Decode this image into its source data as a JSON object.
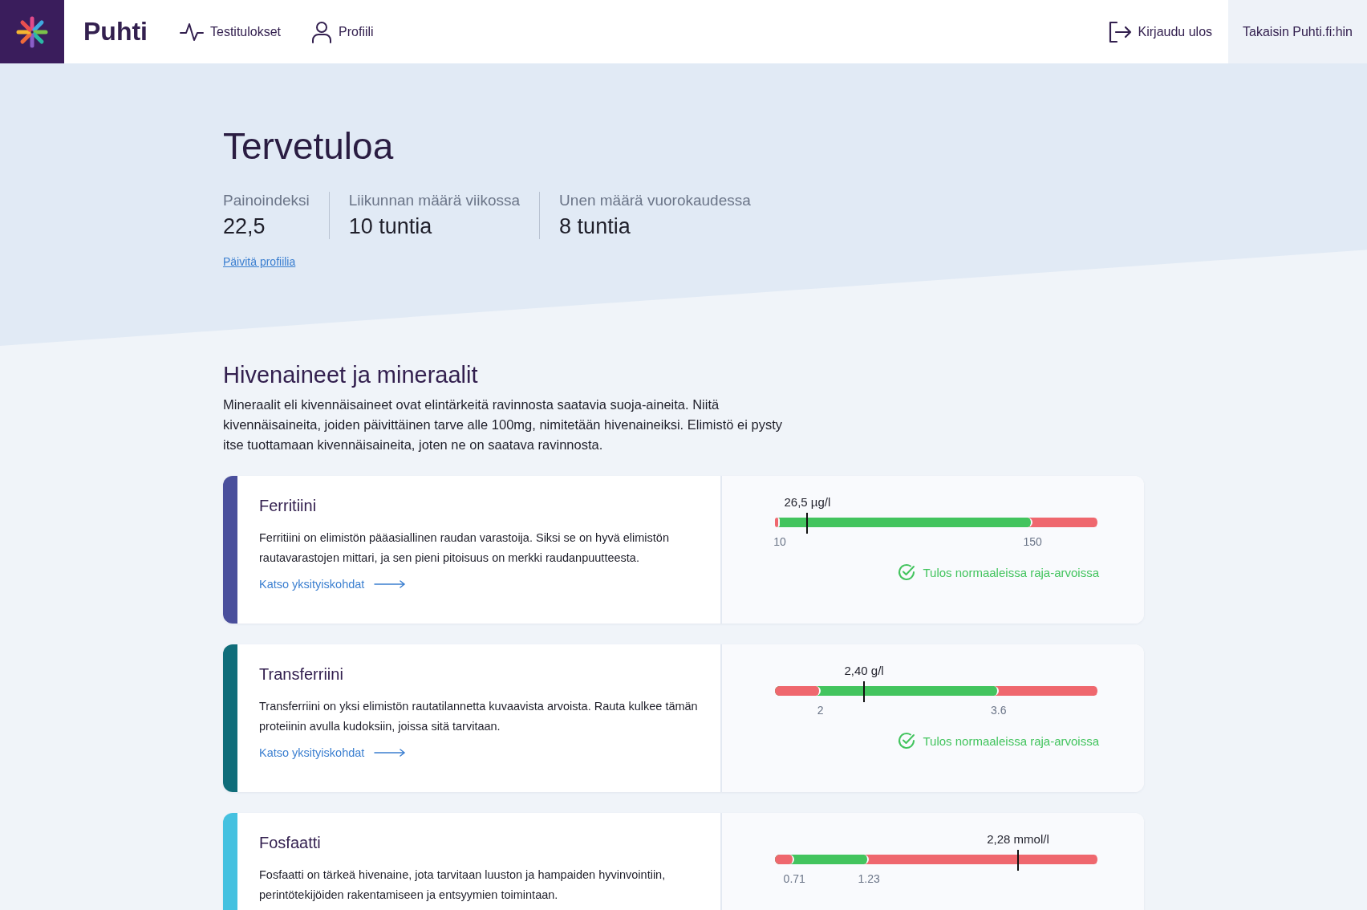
{
  "header": {
    "brand": "Puhti",
    "nav": [
      {
        "label": "Testitulokset",
        "selected": false
      },
      {
        "label": "Profiili",
        "selected": false
      }
    ],
    "logout": "Kirjaudu ulos",
    "back_link": "Takaisin Puhti.fi:hin"
  },
  "hero": {
    "title": "Tervetuloa",
    "stats": [
      {
        "label": "Painoindeksi",
        "value": "22,5"
      },
      {
        "label": "Liikunnan määrä viikossa",
        "value": "10 tuntia"
      },
      {
        "label": "Unen määrä vuorokaudessa",
        "value": "8 tuntia"
      }
    ],
    "update_link": "Päivitä profiilia"
  },
  "section": {
    "title": "Hivenaineet ja mineraalit",
    "description": "Mineraalit eli kivennäisaineet ovat elintärkeitä ravinnosta saatavia suoja-aineita. Niitä kivennäisaineita, joiden päivittäinen tarve alle 100mg, nimitetään hivenaineiksi. Elimistö ei pysty itse tuottamaan kivennäisaineita, joten ne on saatava ravinnosta."
  },
  "cards": [
    {
      "title": "Ferritiini",
      "color": "#4a4f9c",
      "description": "Ferritiini on elimistön pääasiallinen raudan varastoija. Siksi se on hyvä elimistön rautavarastojen mittari, ja sen pieni pitoisuus on merkki raudanpuutteesta.",
      "link": "Katso yksityiskohdat",
      "reading": "26,5 µg/l",
      "marker": {
        "level": 0.1
      },
      "segments": [
        {
          "kind": "low",
          "level": 0.015
        },
        {
          "kind": "normal",
          "level": 0.795,
          "from": "10",
          "to": "150"
        },
        {
          "kind": "high"
        }
      ],
      "status": {
        "kind": "normal",
        "text": "Tulos normaaleissa raja-arvoissa"
      }
    },
    {
      "title": "Transferriini",
      "color": "#106d7a",
      "description": "Transferriini on yksi elimistön rautatilannetta kuvaavista arvoista. Rauta kulkee tämän proteiinin avulla kudoksiin, joissa sitä tarvitaan.",
      "link": "Katso yksityiskohdat",
      "reading": "2,40 g/l",
      "marker": {
        "level": 0.275
      },
      "segments": [
        {
          "kind": "low",
          "level": 0.14
        },
        {
          "kind": "normal",
          "level": 0.69,
          "from": "2",
          "to": "3.6"
        },
        {
          "kind": "high"
        }
      ],
      "status": {
        "kind": "normal",
        "text": "Tulos normaaleissa raja-arvoissa"
      }
    },
    {
      "title": "Fosfaatti",
      "color": "#45c1e0",
      "description": "Fosfaatti on tärkeä hivenaine, jota tarvitaan luuston ja hampaiden hyvinvointiin, perintötekijöiden rakentamiseen ja entsyymien toimintaan.",
      "reading": "2,28 mmol/l",
      "marker": {
        "level": 0.75
      },
      "segments": [
        {
          "kind": "low",
          "level": 0.06
        },
        {
          "kind": "normal",
          "level": 0.29,
          "from": "0.71",
          "to": "1.23"
        },
        {
          "kind": "high"
        }
      ]
    }
  ]
}
